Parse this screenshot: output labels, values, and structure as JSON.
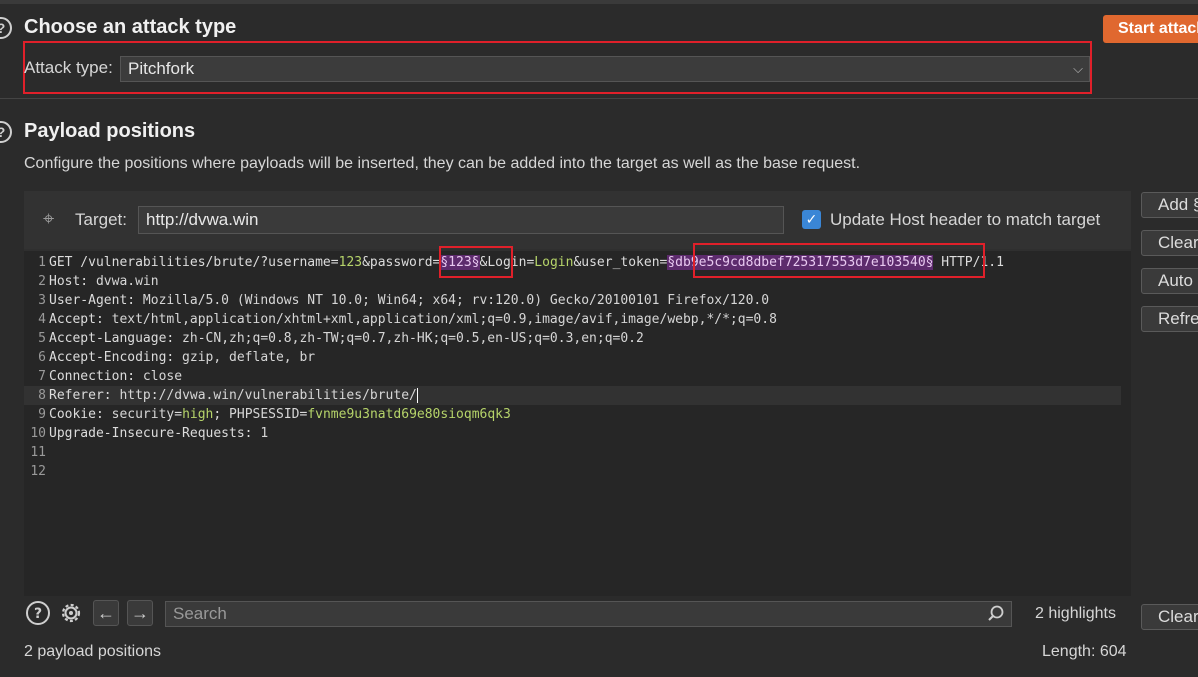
{
  "attack": {
    "section_title": "Choose an attack type",
    "start_button": "Start attack",
    "type_label": "Attack type:",
    "type_value": "Pitchfork"
  },
  "positions": {
    "section_title": "Payload positions",
    "description": "Configure the positions where payloads will be inserted, they can be added into the target as well as the base request.",
    "target_label": "Target:",
    "target_value": "http://dvwa.win",
    "update_host_label": "Update Host header to match target",
    "update_host_checked": true
  },
  "request": {
    "line1": {
      "num": "1",
      "pre": "GET /vulnerabilities/brute/?username=",
      "username": "123",
      "mid1": "&password=",
      "payload1": "§123§",
      "mid2": "&Login=",
      "login": "Login",
      "mid3": "&user_token=",
      "payload2": "§db9e5c9cd8dbef725317553d7e103540§",
      "post": " HTTP/1.1"
    },
    "line2": {
      "num": "2",
      "key": "Host:",
      "val": " dvwa.win"
    },
    "line3": {
      "num": "3",
      "key": "User-Agent:",
      "val": " Mozilla/5.0 (Windows NT 10.0; Win64; x64; rv:120.0) Gecko/20100101 Firefox/120.0"
    },
    "line4": {
      "num": "4",
      "key": "Accept:",
      "val": " text/html,application/xhtml+xml,application/xml;q=0.9,image/avif,image/webp,*/*;q=0.8"
    },
    "line5": {
      "num": "5",
      "key": "Accept-Language:",
      "val": " zh-CN,zh;q=0.8,zh-TW;q=0.7,zh-HK;q=0.5,en-US;q=0.3,en;q=0.2"
    },
    "line6": {
      "num": "6",
      "key": "Accept-Encoding:",
      "val": " gzip, deflate, br"
    },
    "line7": {
      "num": "7",
      "key": "Connection:",
      "val": " close"
    },
    "line8": {
      "num": "8",
      "key": "Referer:",
      "val": " http://dvwa.win/vulnerabilities/brute/"
    },
    "line9": {
      "num": "9",
      "key": "Cookie:",
      "c1k": " security",
      "c1v": "high",
      "sep": "; ",
      "c2k": "PHPSESSID",
      "c2v": "fvnme9u3natd69e80sioqm6qk3"
    },
    "line10": {
      "num": "10",
      "key": "Upgrade-Insecure-Requests:",
      "val": " 1"
    },
    "line11": {
      "num": "11"
    },
    "line12": {
      "num": "12"
    }
  },
  "side_buttons": {
    "add": "Add §",
    "clear": "Clear §",
    "auto": "Auto §",
    "refresh": "Refresh",
    "clear_bottom": "Clear"
  },
  "search": {
    "placeholder": "Search",
    "highlights": "2 highlights"
  },
  "status": {
    "positions_count": "2 payload positions",
    "length": "Length: 604"
  },
  "colors": {
    "accent": "#e0682f",
    "highlight_box": "#e0202a",
    "payload_bg": "#5d2b6d",
    "checkbox": "#3a86d6"
  }
}
